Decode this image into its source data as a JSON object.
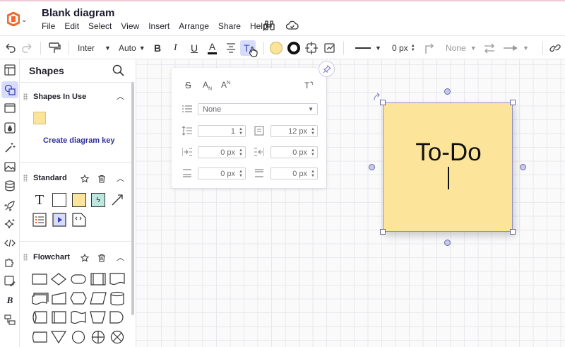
{
  "app": {
    "title": "Blank diagram",
    "menu": [
      "File",
      "Edit",
      "Select",
      "View",
      "Insert",
      "Arrange",
      "Share",
      "Help"
    ]
  },
  "toolbar": {
    "font": "Inter",
    "font_size": "Auto",
    "line_width": "0 px",
    "arrow_start": "None"
  },
  "shapes_panel": {
    "title": "Shapes",
    "sections": {
      "in_use": "Shapes In Use",
      "standard": "Standard",
      "flowchart": "Flowchart"
    },
    "create_key": "Create diagram key"
  },
  "text_popup": {
    "list_style": "None",
    "line_spacing": "1",
    "paragraph_spacing": "12 px",
    "indent_left": "0 px",
    "indent_right": "0 px",
    "space_before": "0 px",
    "space_after": "0 px"
  },
  "canvas": {
    "sticky_text": "To-Do",
    "sticky_color": "#fce59a"
  },
  "colors": {
    "accent": "#3b3fb7",
    "link": "#2f2f9e",
    "logo_orange": "#f2672a"
  }
}
